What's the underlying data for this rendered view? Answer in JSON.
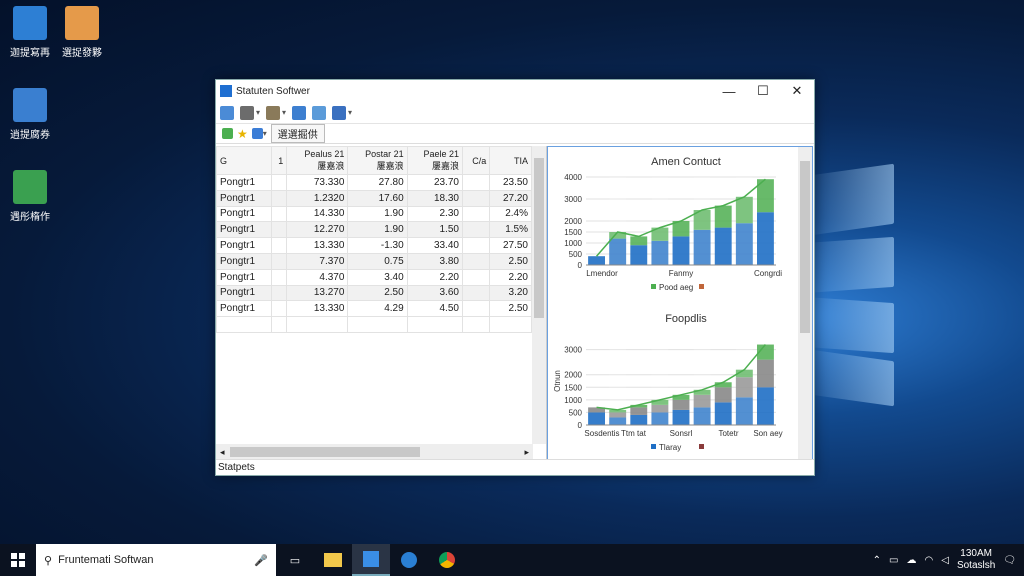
{
  "desktop": {
    "icons": [
      {
        "label": "迦提寫再",
        "color": "#2d7fd4"
      },
      {
        "label": "選捉發夥",
        "color": "#e59a4a"
      },
      {
        "label": "逍提腐券",
        "color": "#3a7fd0"
      },
      {
        "label": "遇彤楕作",
        "color": "#3aa050"
      }
    ]
  },
  "window": {
    "title": "Statuten Softwer",
    "minimize": "—",
    "maximize": "☐",
    "close": "✕",
    "nav_tab": "選選掘供",
    "status_text": "Statpets"
  },
  "grid": {
    "headers": [
      "G",
      "1",
      "Pealus 21\n屢嘉浪",
      "Postar 21\n屢嘉浪",
      "Paele 21\n屢嘉浪",
      "C/a",
      "TIA"
    ],
    "rows": [
      [
        "Pongtr1",
        "",
        "73.330",
        "27.80",
        "23.70",
        "",
        "23.50"
      ],
      [
        "Pongtr1",
        "",
        "1.2320",
        "17.60",
        "18.30",
        "",
        "27.20"
      ],
      [
        "Pongtr1",
        "",
        "14.330",
        "1.90",
        "2.30",
        "",
        "2.4%"
      ],
      [
        "Pongtr1",
        "",
        "12.270",
        "1.90",
        "1.50",
        "",
        "1.5%"
      ],
      [
        "Pongtr1",
        "",
        "13.330",
        "-1.30",
        "33.40",
        "",
        "27.50"
      ],
      [
        "Pongtr1",
        "",
        "7.370",
        "0.75",
        "3.80",
        "",
        "2.50"
      ],
      [
        "Pongtr1",
        "",
        "4.370",
        "3.40",
        "2.20",
        "",
        "2.20"
      ],
      [
        "Pongtr1",
        "",
        "13.270",
        "2.50",
        "3.60",
        "",
        "3.20"
      ],
      [
        "Pongtr1",
        "",
        "13.330",
        "4.29",
        "4.50",
        "",
        "2.50"
      ]
    ]
  },
  "chart_data": [
    {
      "type": "bar",
      "title": "Amen Contuct",
      "xlabel": "",
      "ylabel": "",
      "ylim": [
        0,
        4000
      ],
      "yticks": [
        "0",
        "500",
        "1000",
        "1500",
        "2000",
        "3000",
        "4000"
      ],
      "xticklabels": [
        "Lmendor",
        "Fanmy",
        "Congrdi"
      ],
      "categories": [
        "1",
        "2",
        "3",
        "4",
        "5",
        "6",
        "7",
        "8",
        "9"
      ],
      "series": [
        {
          "name": "",
          "values": [
            400,
            1200,
            900,
            1100,
            1300,
            1600,
            1700,
            1900,
            2400
          ],
          "color": "#1f6fc5"
        },
        {
          "name": "",
          "values": [
            0,
            300,
            400,
            600,
            700,
            900,
            1000,
            1200,
            1500
          ],
          "color": "#58b25a"
        }
      ],
      "legend": "Pood aeg",
      "legend_colors": [
        "#4caf50",
        "#c0663a"
      ]
    },
    {
      "type": "bar",
      "title": "Foopdlis",
      "xlabel": "",
      "ylabel": "Otnun",
      "ylim": [
        0,
        3500
      ],
      "yticks": [
        "0",
        "500",
        "1000",
        "1500",
        "2000",
        "3000"
      ],
      "xticklabels": [
        "Sosdentis",
        "Ttm tat",
        "Sonsrl",
        "Totetr",
        "Son aey"
      ],
      "categories": [
        "1",
        "2",
        "3",
        "4",
        "5",
        "6",
        "7",
        "8",
        "9"
      ],
      "series": [
        {
          "name": "",
          "values": [
            500,
            300,
            400,
            500,
            600,
            700,
            900,
            1100,
            1500
          ],
          "color": "#1f6fc5"
        },
        {
          "name": "",
          "values": [
            200,
            200,
            300,
            300,
            400,
            500,
            600,
            800,
            1100
          ],
          "color": "#888888"
        },
        {
          "name": "",
          "values": [
            0,
            100,
            100,
            200,
            200,
            200,
            200,
            300,
            600
          ],
          "color": "#58b25a"
        }
      ],
      "legend": "Tlaray",
      "legend_colors": [
        "#1f6fc5",
        "#8a3b3b"
      ]
    }
  ],
  "taskbar": {
    "search_text": "Fruntemati Softwan",
    "time": "130AM",
    "date": "Sotaslsh"
  }
}
